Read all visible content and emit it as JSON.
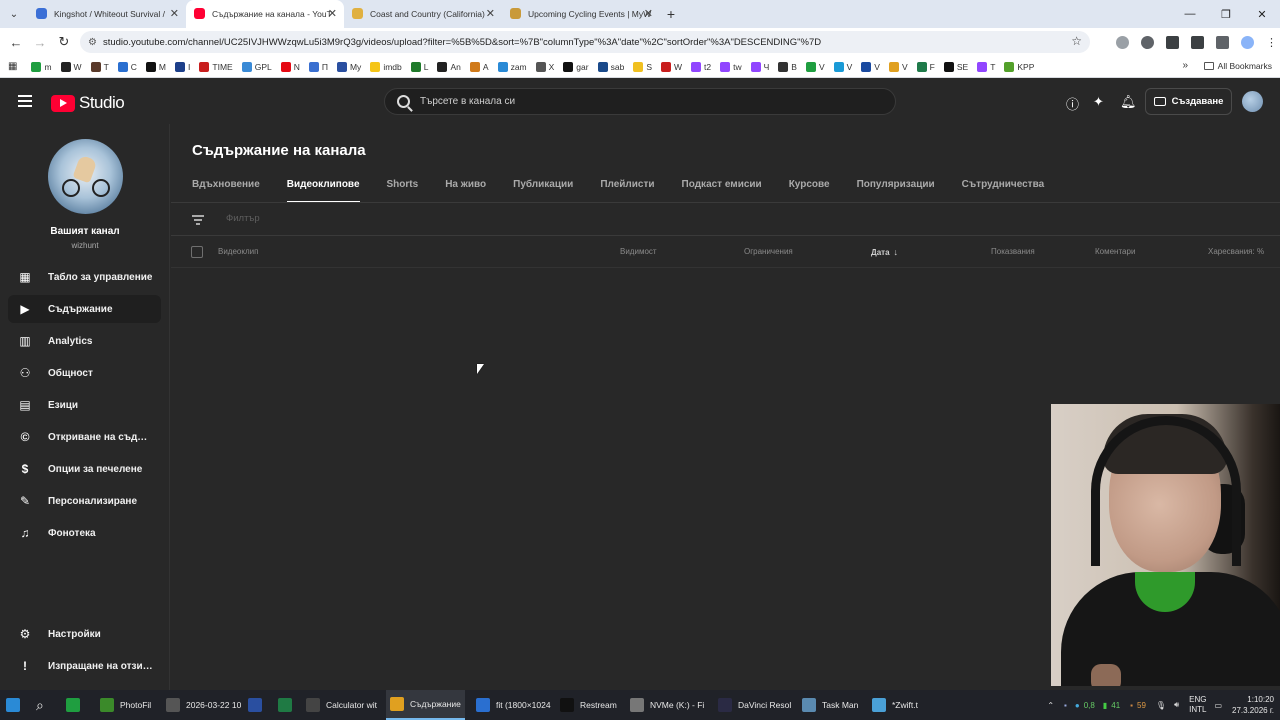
{
  "browser": {
    "tabs": [
      {
        "title": "Kingshot / Whiteout Survival / ",
        "favicon_color": "#3b6fd6",
        "active": false
      },
      {
        "title": "Съдържание на канала - YouT",
        "favicon_color": "#ff0033",
        "active": true
      },
      {
        "title": "Coast and Country (California) ",
        "favicon_color": "#e0b040",
        "active": false
      },
      {
        "title": "Upcoming Cycling Events | MyW",
        "favicon_color": "#c99a3a",
        "active": false
      }
    ],
    "new_tab": "+",
    "url": "studio.youtube.com/channel/UC25IVJHWWzqwLu5i3M9rQ3g/videos/upload?filter=%5B%5D&sort=%7B\"columnType\"%3A\"date\"%2C\"sortOrder\"%3A\"DESCENDING\"%7D",
    "bookmarks": [
      {
        "label": "m",
        "color": "#1f9e40"
      },
      {
        "label": "W",
        "color": "#222222"
      },
      {
        "label": "T",
        "color": "#5a3a2a"
      },
      {
        "label": "C",
        "color": "#2a6fd0"
      },
      {
        "label": "M",
        "color": "#111111"
      },
      {
        "label": "I",
        "color": "#1d3f8a"
      },
      {
        "label": "TIME",
        "color": "#c81e1e"
      },
      {
        "label": "GPL",
        "color": "#3a8ad6"
      },
      {
        "label": "N",
        "color": "#e50914"
      },
      {
        "label": "П",
        "color": "#3a6fd0"
      },
      {
        "label": "My",
        "color": "#2a4fa0"
      },
      {
        "label": "imdb",
        "color": "#f5c518"
      },
      {
        "label": "L",
        "color": "#1f7a2a"
      },
      {
        "label": "An",
        "color": "#222222"
      },
      {
        "label": "A",
        "color": "#d07a1a"
      },
      {
        "label": "zam",
        "color": "#2a8ad6"
      },
      {
        "label": "X",
        "color": "#555555"
      },
      {
        "label": "gar",
        "color": "#111111"
      },
      {
        "label": "sab",
        "color": "#1a4a8a"
      },
      {
        "label": "S",
        "color": "#f0c020"
      },
      {
        "label": "W",
        "color": "#c81e1e"
      },
      {
        "label": "t2",
        "color": "#9146ff"
      },
      {
        "label": "tw",
        "color": "#9146ff"
      },
      {
        "label": "Ч",
        "color": "#9146ff"
      },
      {
        "label": "B",
        "color": "#333333"
      },
      {
        "label": "V",
        "color": "#1f9e40"
      },
      {
        "label": "V",
        "color": "#1a9ad6"
      },
      {
        "label": "V",
        "color": "#1a4aa0"
      },
      {
        "label": "V",
        "color": "#e0a020"
      },
      {
        "label": "F",
        "color": "#1f7a4a"
      },
      {
        "label": "SE",
        "color": "#111111"
      },
      {
        "label": "T",
        "color": "#9146ff"
      },
      {
        "label": "KPP",
        "color": "#53a02a"
      }
    ],
    "all_bookmarks": "All Bookmarks"
  },
  "studio": {
    "logo_text": "Studio",
    "search_placeholder": "Търсете в канала си",
    "create_label": "Създаване",
    "channel": {
      "name": "Вашият канал",
      "handle": "wizhunt"
    },
    "nav": [
      {
        "label": "Табло за управление",
        "icon": "dashboard-icon",
        "selected": false
      },
      {
        "label": "Съдържание",
        "icon": "content-icon",
        "selected": true
      },
      {
        "label": "Analytics",
        "icon": "analytics-icon",
        "selected": false
      },
      {
        "label": "Общност",
        "icon": "community-icon",
        "selected": false
      },
      {
        "label": "Езици",
        "icon": "subtitles-icon",
        "selected": false
      },
      {
        "label": "Откриване на съдър...",
        "icon": "copyright-icon",
        "selected": false
      },
      {
        "label": "Опции за печелене",
        "icon": "monetization-icon",
        "selected": false
      },
      {
        "label": "Персонализиране",
        "icon": "customization-icon",
        "selected": false
      },
      {
        "label": "Фонотека",
        "icon": "audio-library-icon",
        "selected": false
      }
    ],
    "nav_bottom": [
      {
        "label": "Настройки",
        "icon": "settings-icon"
      },
      {
        "label": "Изпращане на отзиви",
        "icon": "feedback-icon"
      }
    ],
    "page_title": "Съдържание на канала",
    "content_tabs": [
      {
        "label": "Вдъхновение",
        "active": false
      },
      {
        "label": "Видеоклипове",
        "active": true
      },
      {
        "label": "Shorts",
        "active": false
      },
      {
        "label": "На живо",
        "active": false
      },
      {
        "label": "Публикации",
        "active": false
      },
      {
        "label": "Плейлисти",
        "active": false
      },
      {
        "label": "Подкаст емисии",
        "active": false
      },
      {
        "label": "Курсове",
        "active": false
      },
      {
        "label": "Популяризации",
        "active": false
      },
      {
        "label": "Сътрудничества",
        "active": false
      }
    ],
    "filter_placeholder": "Филтър",
    "table_headers": {
      "video": "Видеоклип",
      "visibility": "Видимост",
      "restrictions": "Ограничения",
      "date": "Дата",
      "views": "Показвания",
      "comments": "Коментари",
      "likes": "Харесвания: %"
    }
  },
  "taskbar": {
    "items": [
      {
        "label": "PhotoFil",
        "color": "#3b8a2a"
      },
      {
        "label": "2026-03-22 10",
        "color": "#555555"
      },
      {
        "label": "",
        "color": "#2a4fa0"
      },
      {
        "label": "",
        "color": "#1f7a44"
      },
      {
        "label": "Calculator wit",
        "color": "#444444"
      },
      {
        "label": "Съдържание",
        "color": "#e0a020"
      },
      {
        "label": "fit (1800×1024",
        "color": "#2a6fd0"
      },
      {
        "label": "Restream",
        "color": "#111111"
      },
      {
        "label": "NVMe (K:) - Fi",
        "color": "#777777"
      },
      {
        "label": "DaVinci Resol",
        "color": "#2a2a44"
      },
      {
        "label": "Task Man",
        "color": "#5a8ab0"
      },
      {
        "label": "*Zwift.t",
        "color": "#4aa0d6"
      }
    ],
    "tray_values": [
      "0,8",
      "41",
      "59"
    ],
    "lang_top": "ENG",
    "lang_bottom": "INTL",
    "time": "1:10:20",
    "date": "27.3.2026 г."
  }
}
